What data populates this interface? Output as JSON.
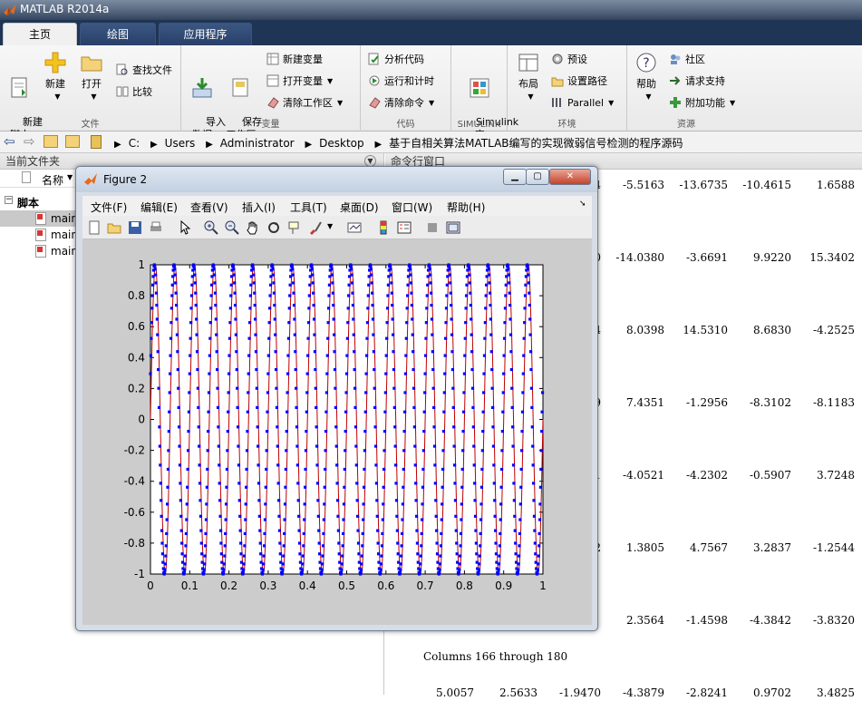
{
  "app": {
    "title": "MATLAB R2014a"
  },
  "tabs": [
    {
      "label": "主页",
      "active": true
    },
    {
      "label": "绘图",
      "active": false
    },
    {
      "label": "应用程序",
      "active": false
    }
  ],
  "ribbon": {
    "file_group": {
      "label": "文件",
      "new_script": "新建\n脚本",
      "new": "新建",
      "open": "打开",
      "find_files": "查找文件",
      "compare": "比较"
    },
    "variable_group": {
      "label": "变量",
      "import": "导入\n数据",
      "save_ws": "保存\n工作区",
      "new_var": "新建变量",
      "open_var": "打开变量",
      "clear_ws": "清除工作区"
    },
    "code_group": {
      "label": "代码",
      "analyze": "分析代码",
      "run_time": "运行和计时",
      "clear_cmd": "清除命令"
    },
    "simulink_group": {
      "label": "SIMULINK",
      "simulink": "Simulink\n库"
    },
    "env_group": {
      "label": "环境",
      "layout": "布局",
      "prefs": "预设",
      "set_path": "设置路径",
      "parallel": "Parallel"
    },
    "resources_group": {
      "label": "资源",
      "help": "帮助",
      "community": "社区",
      "support": "请求支持",
      "addons": "附加功能"
    }
  },
  "address": {
    "crumbs": [
      "C:",
      "Users",
      "Administrator",
      "Desktop",
      "基于自相关算法MATLAB编写的实现微弱信号检测的程序源码"
    ]
  },
  "current_folder": {
    "title": "当前文件夹",
    "col_name": "名称",
    "group": "脚本",
    "files": [
      "main",
      "main",
      "main"
    ]
  },
  "command_window": {
    "title": "命令行窗口",
    "rows": [
      [
        "4",
        "-5.5163",
        "-13.6735",
        "-10.4615",
        "1.6588"
      ],
      [
        "0",
        "-14.0380",
        "-3.6691",
        "9.9220",
        "15.3402"
      ],
      [
        "4",
        "8.0398",
        "14.5310",
        "8.6830",
        "-4.2525"
      ],
      [
        "9",
        "7.4351",
        "-1.2956",
        "-8.3102",
        "-8.1183"
      ],
      [
        "1",
        "-4.0521",
        "-4.2302",
        "-0.5907",
        "3.7248"
      ],
      [
        "2",
        "1.3805",
        "4.7567",
        "3.2837",
        "-1.2544"
      ],
      [
        "",
        "2.3564",
        "-1.4598",
        "-4.3842",
        "-3.8320"
      ]
    ],
    "columns_line": "Columns 166 through 180",
    "last_row": [
      "5.0057",
      "2.5633",
      "-1.9470",
      "-4.3879",
      "-2.8241",
      "0.9702",
      "3.4825"
    ]
  },
  "figure": {
    "title": "Figure 2",
    "menu": [
      "文件(F)",
      "编辑(E)",
      "查看(V)",
      "插入(I)",
      "工具(T)",
      "桌面(D)",
      "窗口(W)",
      "帮助(H)"
    ],
    "toolbar_icons": [
      "new-figure-icon",
      "open-file-icon",
      "save-icon",
      "print-icon",
      "pointer-icon",
      "zoom-in-icon",
      "zoom-out-icon",
      "pan-icon",
      "rotate-icon",
      "data-cursor-icon",
      "brush-icon",
      "link-icon",
      "colorbar-icon",
      "legend-icon",
      "hide-plot-tools-icon",
      "show-plot-tools-icon"
    ]
  },
  "chart_data": {
    "type": "line",
    "title": "",
    "xlabel": "",
    "ylabel": "",
    "xlim": [
      0,
      1
    ],
    "ylim": [
      -1,
      1
    ],
    "xticks": [
      "0",
      "0.1",
      "0.2",
      "0.3",
      "0.4",
      "0.5",
      "0.6",
      "0.7",
      "0.8",
      "0.9",
      "1"
    ],
    "yticks": [
      "-1",
      "-0.8",
      "-0.6",
      "-0.4",
      "-0.2",
      "0",
      "0.2",
      "0.4",
      "0.6",
      "0.8",
      "1"
    ],
    "series": [
      {
        "style": "line",
        "color": "#c00000",
        "function": "sin",
        "frequency": 20,
        "amplitude": 1
      },
      {
        "style": "markers",
        "color": "#0000ff",
        "marker": "dot",
        "function": "sin",
        "frequency": 20,
        "amplitude": 1,
        "points": 1000
      }
    ]
  },
  "colors": {
    "accent": "#1f3555",
    "plot_line": "#c00000",
    "plot_marker": "#0000ff"
  }
}
